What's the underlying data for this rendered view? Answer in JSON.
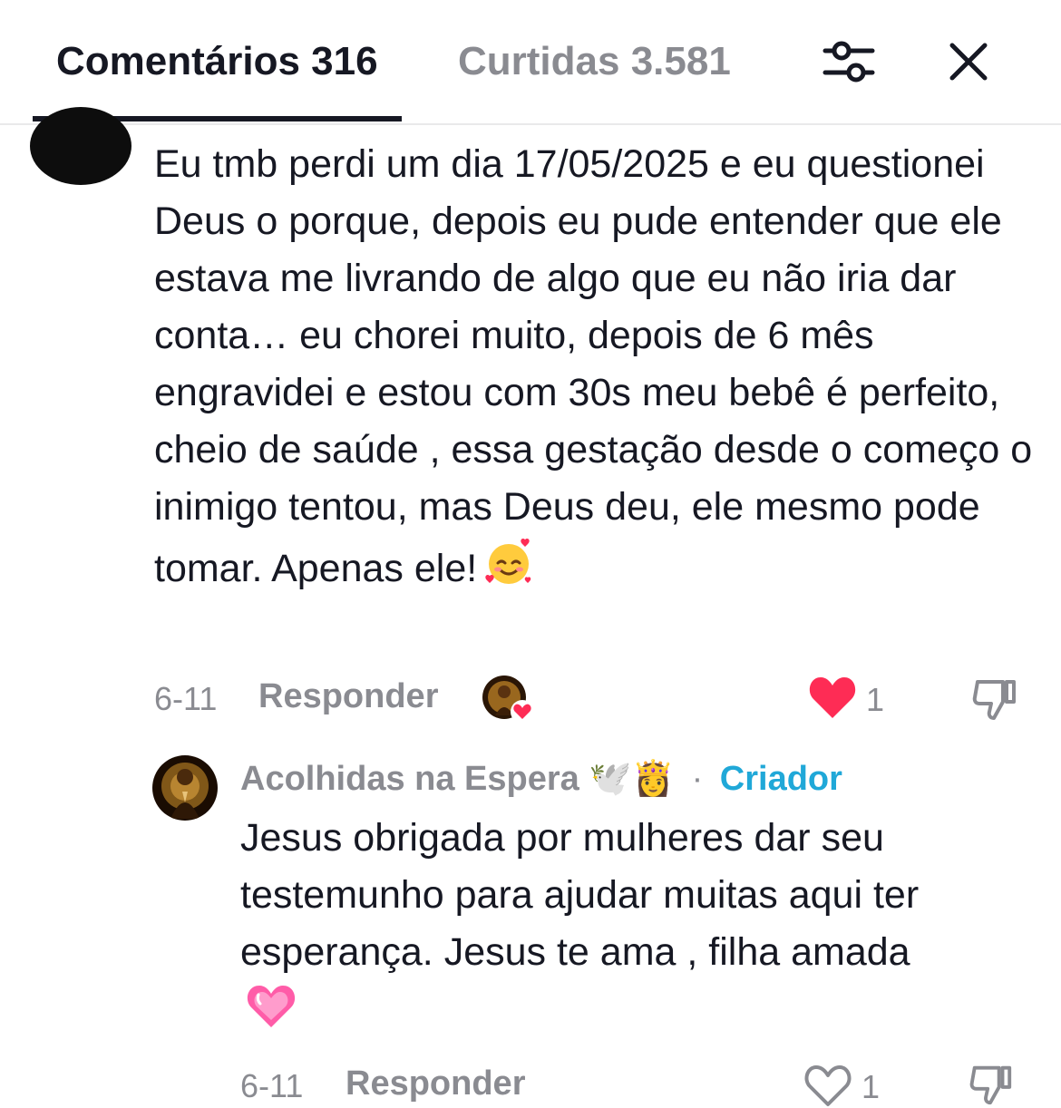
{
  "tabs": {
    "comments_label": "Comentários 316",
    "likes_label": "Curtidas 3.581"
  },
  "icons": {
    "filter": "sliders-icon",
    "close": "close-icon",
    "like_filled": "heart-filled-icon",
    "like_outline": "heart-outline-icon",
    "dislike": "thumbs-down-icon"
  },
  "colors": {
    "heart": "#fe2c55",
    "creator": "#20a8d8",
    "muted": "#8a8b91"
  },
  "comments": [
    {
      "text": "Eu tmb perdi um dia 17/05/2025 e eu questionei Deus o porque, depois eu pude entender que ele estava me livrando de algo que eu não iria dar conta… eu chorei muito, depois de 6 mês engravidei e estou com 30s meu bebê é perfeito, cheio de saúde , essa gestação desde o começo o inimigo tentou, mas Deus deu, ele mesmo pode tomar. Apenas ele!",
      "date": "6-11",
      "reply_label": "Responder",
      "likes": "1",
      "liked": true
    },
    {
      "author": "Acolhidas na Espera",
      "author_emojis": "🕊️👸",
      "badge": "Criador",
      "separator": "·",
      "text": "Jesus obrigada por mulheres dar seu testemunho para ajudar muitas aqui ter esperança. Jesus te ama , filha amada",
      "date": "6-11",
      "reply_label": "Responder",
      "likes": "1",
      "liked": false
    }
  ]
}
